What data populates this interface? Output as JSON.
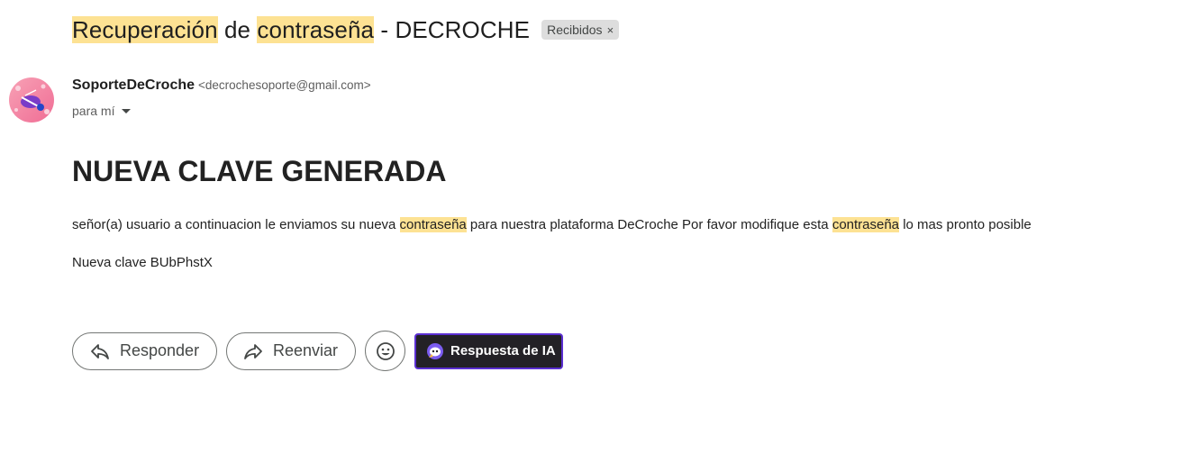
{
  "subject": {
    "parts": [
      {
        "text": "Recuperación",
        "highlighted": true
      },
      {
        "text": " de ",
        "highlighted": false
      },
      {
        "text": "contraseña",
        "highlighted": true
      },
      {
        "text": " - DECROCHE",
        "highlighted": false
      }
    ],
    "label": "Recibidos",
    "label_remove": "×"
  },
  "sender": {
    "name": "SoporteDeCroche",
    "email": "<decrochesoporte@gmail.com>",
    "to": "para mí"
  },
  "message": {
    "heading": "NUEVA CLAVE GENERADA",
    "paragraph": [
      {
        "text": "señor(a) usuario a continuacion le enviamos su nueva ",
        "highlighted": false
      },
      {
        "text": "contraseña",
        "highlighted": true
      },
      {
        "text": " para nuestra plataforma DeCroche Por favor modifique esta ",
        "highlighted": false
      },
      {
        "text": "contraseña",
        "highlighted": true
      },
      {
        "text": " lo mas pronto posible",
        "highlighted": false
      }
    ],
    "new_key": "Nueva clave BUbPhstX"
  },
  "actions": {
    "reply_label": "Responder",
    "forward_label": "Reenviar",
    "ai_label": "Respuesta de IA"
  },
  "icons": {
    "reply": "reply-arrow-icon",
    "forward": "forward-arrow-icon",
    "emoji": "smiley-icon",
    "ai": "ai-assistant-icon",
    "dropdown": "caret-down-icon"
  },
  "colors": {
    "highlight": "#fde293",
    "ai_button_bg": "#232126",
    "ai_button_border": "#5b2fd1",
    "label_chip_bg": "#dddddd"
  }
}
